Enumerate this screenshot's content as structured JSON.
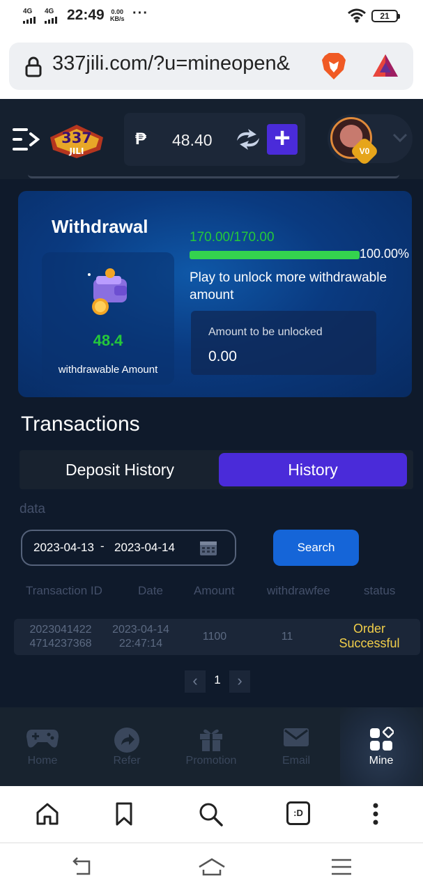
{
  "status_bar": {
    "sim1": "4G",
    "sim2": "4G",
    "time": "22:49",
    "speed_value": "0.00",
    "speed_unit": "KB/s",
    "more": "···",
    "battery": "21"
  },
  "browser": {
    "url": "337jili.com/?u=mineopen&",
    "icons": [
      "lock-icon",
      "brave-lion-icon",
      "bat-triangle-icon"
    ]
  },
  "header": {
    "logo_text_top": "337",
    "logo_text_bottom": "JILI",
    "currency_symbol": "₱",
    "balance": "48.40",
    "plus_label": "+",
    "vip_label": "V0"
  },
  "withdrawal": {
    "title": "Withdrawal",
    "amount": "48.4",
    "amount_label": "withdrawable Amount",
    "progress_text": "170.00/170.00",
    "progress_fraction": 1.0,
    "progress_percent": "100.00%",
    "unlock_text": "Play to unlock more withdrawable amount",
    "unlock_box_label": "Amount to be unlocked",
    "unlock_box_value": "0.00"
  },
  "transactions": {
    "title": "Transactions",
    "tabs": [
      {
        "label": "Deposit History",
        "active": false
      },
      {
        "label": "History",
        "active": true
      }
    ],
    "data_label": "data",
    "date_from": "2023-04-13",
    "date_separator": "-",
    "date_to": "2023-04-14",
    "search_label": "Search",
    "columns": [
      "Transaction ID",
      "Date",
      "Amount",
      "withdrawfee",
      "status"
    ],
    "rows": [
      {
        "id_line1": "2023041422",
        "id_line2": "4714237368",
        "date_line1": "2023-04-14",
        "date_line2": "22:47:14",
        "amount": "1100",
        "fee": "11",
        "status_line1": "Order",
        "status_line2": "Successful"
      }
    ],
    "pagination": {
      "prev": "‹",
      "page": "1",
      "next": "›"
    }
  },
  "bottom_nav": {
    "items": [
      {
        "label": "Home",
        "icon": "gamepad-icon",
        "active": false
      },
      {
        "label": "Refer",
        "icon": "share-icon",
        "active": false
      },
      {
        "label": "Promotion",
        "icon": "gift-icon",
        "active": false
      },
      {
        "label": "Email",
        "icon": "mail-icon",
        "active": false
      },
      {
        "label": "Mine",
        "icon": "grid-icon",
        "active": true
      }
    ]
  },
  "browser_toolbar": {
    "tabs_label": ":D"
  },
  "colors": {
    "accent_purple": "#4a2bd9",
    "search_blue": "#1565d8",
    "progress_green": "#34d34e",
    "status_gold": "#f2cf4a"
  }
}
